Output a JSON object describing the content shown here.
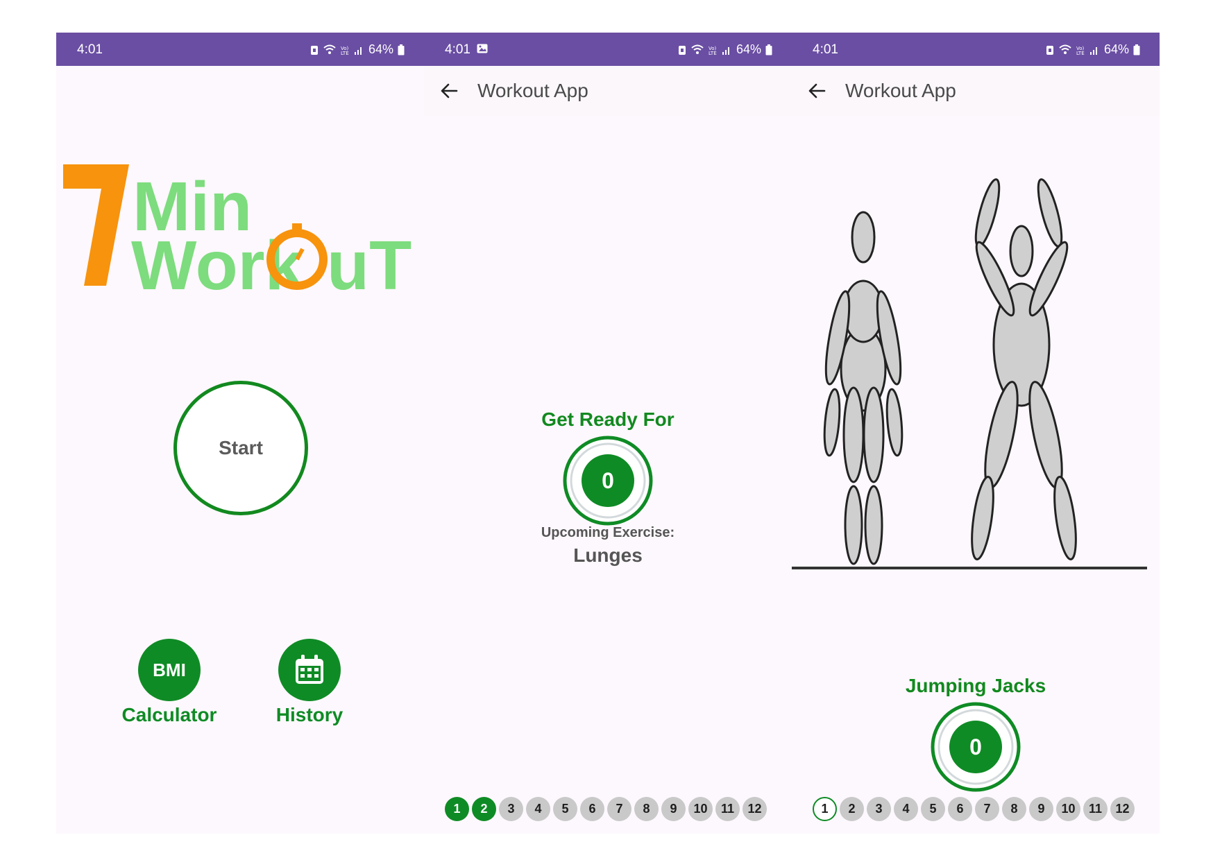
{
  "status_bar": {
    "time": "4:01",
    "battery": "64%"
  },
  "home": {
    "logo": {
      "number": "7",
      "line1": "Min",
      "line2_a": "Work",
      "line2_b": "uT"
    },
    "start_label": "Start",
    "bmi_icon_text": "BMI",
    "bmi_caption": "Calculator",
    "history_caption": "History"
  },
  "rest_screen": {
    "app_title": "Workout App",
    "get_ready_label": "Get Ready For",
    "timer_value": "0",
    "upcoming_label": "Upcoming Exercise:",
    "upcoming_name": "Lunges",
    "progress": [
      "1",
      "2",
      "3",
      "4",
      "5",
      "6",
      "7",
      "8",
      "9",
      "10",
      "11",
      "12"
    ]
  },
  "exercise_screen": {
    "app_title": "Workout App",
    "exercise_name": "Jumping Jacks",
    "timer_value": "0",
    "progress": [
      "1",
      "2",
      "3",
      "4",
      "5",
      "6",
      "7",
      "8",
      "9",
      "10",
      "11",
      "12"
    ]
  },
  "colors": {
    "status_bar": "#6a4ea3",
    "accent_green": "#0f8b25",
    "logo_orange": "#f7930d",
    "logo_green": "#7ddc7e"
  },
  "icons": [
    "back-arrow-icon",
    "calendar-icon",
    "gallery-icon",
    "wifi-icon",
    "signal-icon",
    "battery-icon",
    "lock-icon"
  ]
}
